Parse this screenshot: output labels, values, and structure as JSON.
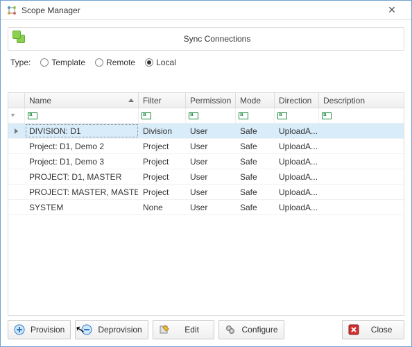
{
  "window": {
    "title": "Scope Manager"
  },
  "sync": {
    "label": "Sync Connections"
  },
  "type": {
    "label": "Type:",
    "options": {
      "template": "Template",
      "remote": "Remote",
      "local": "Local"
    },
    "selected": "local"
  },
  "grid": {
    "columns": {
      "name": "Name",
      "filter": "Filter",
      "permission": "Permission",
      "mode": "Mode",
      "direction": "Direction",
      "description": "Description"
    },
    "rows": [
      {
        "expandable": true,
        "name": "DIVISION: D1",
        "filter": "Division",
        "permission": "User",
        "mode": "Safe",
        "direction": "UploadA...",
        "description": ""
      },
      {
        "expandable": false,
        "name": "Project: D1, Demo 2",
        "filter": "Project",
        "permission": "User",
        "mode": "Safe",
        "direction": "UploadA...",
        "description": ""
      },
      {
        "expandable": false,
        "name": "Project: D1, Demo 3",
        "filter": "Project",
        "permission": "User",
        "mode": "Safe",
        "direction": "UploadA...",
        "description": ""
      },
      {
        "expandable": false,
        "name": "PROJECT: D1, MASTER",
        "filter": "Project",
        "permission": "User",
        "mode": "Safe",
        "direction": "UploadA...",
        "description": ""
      },
      {
        "expandable": false,
        "name": "PROJECT: MASTER, MASTER",
        "filter": "Project",
        "permission": "User",
        "mode": "Safe",
        "direction": "UploadA...",
        "description": ""
      },
      {
        "expandable": false,
        "name": "SYSTEM",
        "filter": "None",
        "permission": "User",
        "mode": "Safe",
        "direction": "UploadA...",
        "description": ""
      }
    ],
    "selected_index": 0
  },
  "toolbar": {
    "provision": "Provision",
    "deprovision": "Deprovision",
    "edit": "Edit",
    "configure": "Configure",
    "close": "Close"
  }
}
